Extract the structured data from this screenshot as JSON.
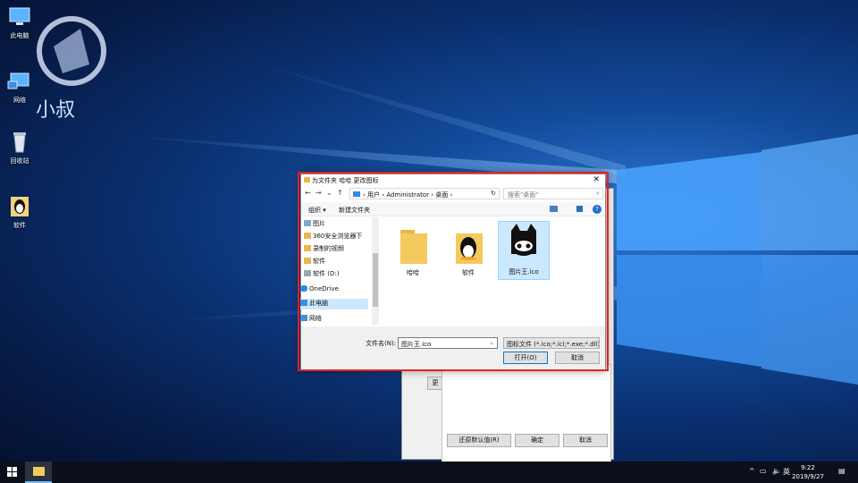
{
  "desktop": {
    "icons": [
      {
        "label": "此电脑",
        "icon": "this-pc-icon"
      },
      {
        "label": "网络",
        "icon": "network-icon"
      },
      {
        "label": "回收站",
        "icon": "recycle-bin-icon"
      },
      {
        "label": "软件",
        "icon": "qq-penguin-icon"
      }
    ],
    "watermark_text": "小叔"
  },
  "background_window": {
    "button_partial": "更",
    "restore_label": "还原默认值(R)",
    "ok_label": "确定",
    "cancel_label": "取消"
  },
  "dialog": {
    "title": "为文件夹 哈哈 更改图标",
    "close_glyph": "✕",
    "nav": {
      "back": "←",
      "forward": "→",
      "dropdown": "⌄",
      "up": "↑"
    },
    "address": {
      "crumbs": [
        "用户",
        "Administrator",
        "桌面"
      ],
      "separator": "›"
    },
    "search_placeholder": "搜索\"桌面\"",
    "toolbar": {
      "organize": "组织 ▾",
      "new_folder": "新建文件夹"
    },
    "tree": [
      {
        "label": "图片",
        "icon": "pictures-icon"
      },
      {
        "label": "360安全浏览器下",
        "icon": "folder-icon"
      },
      {
        "label": "录制的视频",
        "icon": "folder-icon"
      },
      {
        "label": "软件",
        "icon": "folder-icon"
      },
      {
        "label": "软件 (D:)",
        "icon": "drive-icon"
      },
      {
        "label": "OneDrive",
        "icon": "onedrive-icon"
      },
      {
        "label": "此电脑",
        "icon": "this-pc-icon"
      },
      {
        "label": "网络",
        "icon": "network-icon"
      }
    ],
    "files": [
      {
        "label": "哈哈",
        "icon": "folder-icon"
      },
      {
        "label": "软件",
        "icon": "qq-folder-icon"
      },
      {
        "label": "图片王.ico",
        "icon": "github-cat-icon"
      }
    ],
    "filename_label": "文件名(N):",
    "filename_value": "图片王.ico",
    "filetype_value": "图标文件 (*.ico;*.icl;*.exe;*.dll)",
    "open_label": "打开(O)",
    "cancel_label": "取消"
  },
  "taskbar": {
    "tray_ime": "英",
    "time": "9:22",
    "date": "2019/9/27"
  },
  "colors": {
    "highlight": "#e82020",
    "selection": "#cce8ff",
    "accent": "#0078d7"
  }
}
